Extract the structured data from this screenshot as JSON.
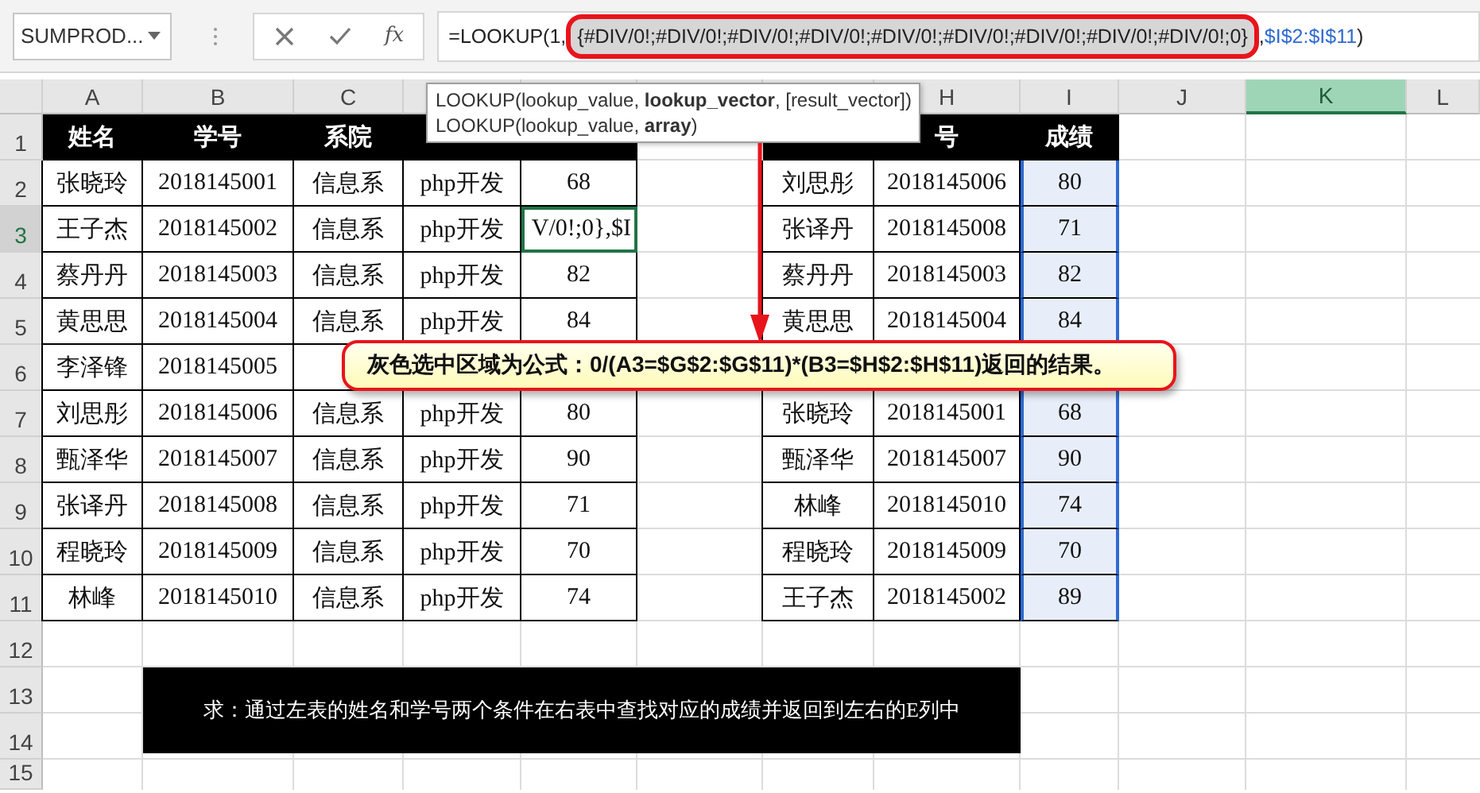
{
  "formula_bar": {
    "name_box": "SUMPROD...",
    "function_button": "fx",
    "parts": [
      {
        "kind": "plain",
        "text": "=LOOKUP(1,"
      },
      {
        "kind": "array",
        "text": "{#DIV/0!;#DIV/0!;#DIV/0!;#DIV/0!;#DIV/0!;#DIV/0!;#DIV/0!;#DIV/0!;#DIV/0!;0}"
      },
      {
        "kind": "plain",
        "text": ","
      },
      {
        "kind": "reference",
        "text": "$I$2:$I$11"
      },
      {
        "kind": "plain",
        "text": ")"
      }
    ]
  },
  "tooltip": {
    "lines": [
      "LOOKUP(lookup_value, **lookup_vector**, [result_vector])",
      "LOOKUP(lookup_value, **array**)"
    ]
  },
  "sheet": {
    "columns": [
      {
        "label": "A",
        "selected": false
      },
      {
        "label": "B",
        "selected": false
      },
      {
        "label": "C",
        "selected": false
      },
      {
        "selected": false
      },
      {
        "selected": false
      },
      {
        "selected": false
      },
      {
        "selected": false
      },
      {
        "label": "H",
        "selected": false
      },
      {
        "label": "I",
        "selected": false
      },
      {
        "label": "J",
        "selected": false
      },
      {
        "label": "K",
        "selected": true
      },
      {
        "label": "L",
        "selected": false
      }
    ],
    "rows": [
      {
        "number": "1",
        "selected": false,
        "cells": [
          {
            "kind": "header",
            "text": "姓名"
          },
          {
            "kind": "header",
            "text": "学号"
          },
          {
            "kind": "header",
            "text": "系院"
          },
          {
            "kind": "header"
          },
          {
            "kind": "header"
          },
          {
            "kind": "blank"
          },
          {
            "kind": "header"
          },
          {
            "kind": "header",
            "text": "号"
          },
          {
            "kind": "header",
            "text": "成绩"
          }
        ]
      },
      {
        "number": "2",
        "selected": false,
        "cells": [
          {
            "kind": "text",
            "text": "张晓玲"
          },
          {
            "kind": "text",
            "text": "2018145001"
          },
          {
            "kind": "text",
            "text": "信息系"
          },
          {
            "kind": "text",
            "text": "php开发"
          },
          {
            "kind": "text",
            "text": "68"
          },
          {
            "kind": "blank"
          },
          {
            "kind": "text",
            "text": "刘思彤"
          },
          {
            "kind": "text",
            "text": "2018145006"
          },
          {
            "kind": "reference",
            "text": "80"
          }
        ]
      },
      {
        "number": "3",
        "selected": true,
        "cells": [
          {
            "kind": "text",
            "text": "王子杰"
          },
          {
            "kind": "text",
            "text": "2018145002"
          },
          {
            "kind": "text",
            "text": "信息系"
          },
          {
            "kind": "text",
            "text": "php开发"
          },
          {
            "kind": "editing",
            "text": "V/0!;0},$I"
          },
          {
            "kind": "blank"
          },
          {
            "kind": "text",
            "text": "张译丹"
          },
          {
            "kind": "text",
            "text": "2018145008"
          },
          {
            "kind": "reference",
            "text": "71"
          }
        ]
      },
      {
        "number": "4",
        "selected": false,
        "cells": [
          {
            "kind": "text",
            "text": "蔡丹丹"
          },
          {
            "kind": "text",
            "text": "2018145003"
          },
          {
            "kind": "text",
            "text": "信息系"
          },
          {
            "kind": "text",
            "text": "php开发"
          },
          {
            "kind": "text",
            "text": "82"
          },
          {
            "kind": "blank"
          },
          {
            "kind": "text",
            "text": "蔡丹丹"
          },
          {
            "kind": "text",
            "text": "2018145003"
          },
          {
            "kind": "reference",
            "text": "82"
          }
        ]
      },
      {
        "number": "5",
        "selected": false,
        "cells": [
          {
            "kind": "text",
            "text": "黄思思"
          },
          {
            "kind": "text",
            "text": "2018145004"
          },
          {
            "kind": "text",
            "text": "信息系"
          },
          {
            "kind": "text",
            "text": "php开发"
          },
          {
            "kind": "text",
            "text": "84"
          },
          {
            "kind": "blank"
          },
          {
            "kind": "text",
            "text": "黄思思"
          },
          {
            "kind": "text",
            "text": "2018145004"
          },
          {
            "kind": "reference",
            "text": "84"
          }
        ]
      },
      {
        "number": "6",
        "selected": false,
        "cells": [
          {
            "kind": "text",
            "text": "李泽锋"
          },
          {
            "kind": "text",
            "text": "2018145005"
          },
          {
            "kind": "text"
          },
          {
            "kind": "text"
          },
          {
            "kind": "text"
          },
          {
            "kind": "blank"
          },
          {
            "kind": "text"
          },
          {
            "kind": "text"
          },
          {
            "kind": "reference"
          }
        ]
      },
      {
        "number": "7",
        "selected": false,
        "cells": [
          {
            "kind": "text",
            "text": "刘思彤"
          },
          {
            "kind": "text",
            "text": "2018145006"
          },
          {
            "kind": "text",
            "text": "信息系"
          },
          {
            "kind": "text",
            "text": "php开发"
          },
          {
            "kind": "text",
            "text": "80"
          },
          {
            "kind": "blank"
          },
          {
            "kind": "text",
            "text": "张晓玲"
          },
          {
            "kind": "text",
            "text": "2018145001"
          },
          {
            "kind": "reference",
            "text": "68"
          }
        ]
      },
      {
        "number": "8",
        "selected": false,
        "cells": [
          {
            "kind": "text",
            "text": "甄泽华"
          },
          {
            "kind": "text",
            "text": "2018145007"
          },
          {
            "kind": "text",
            "text": "信息系"
          },
          {
            "kind": "text",
            "text": "php开发"
          },
          {
            "kind": "text",
            "text": "90"
          },
          {
            "kind": "blank"
          },
          {
            "kind": "text",
            "text": "甄泽华"
          },
          {
            "kind": "text",
            "text": "2018145007"
          },
          {
            "kind": "reference",
            "text": "90"
          }
        ]
      },
      {
        "number": "9",
        "selected": false,
        "cells": [
          {
            "kind": "text",
            "text": "张译丹"
          },
          {
            "kind": "text",
            "text": "2018145008"
          },
          {
            "kind": "text",
            "text": "信息系"
          },
          {
            "kind": "text",
            "text": "php开发"
          },
          {
            "kind": "text",
            "text": "71"
          },
          {
            "kind": "blank"
          },
          {
            "kind": "text",
            "text": "林峰"
          },
          {
            "kind": "text",
            "text": "2018145010"
          },
          {
            "kind": "reference",
            "text": "74"
          }
        ]
      },
      {
        "number": "10",
        "selected": false,
        "cells": [
          {
            "kind": "text",
            "text": "程晓玲"
          },
          {
            "kind": "text",
            "text": "2018145009"
          },
          {
            "kind": "text",
            "text": "信息系"
          },
          {
            "kind": "text",
            "text": "php开发"
          },
          {
            "kind": "text",
            "text": "70"
          },
          {
            "kind": "blank"
          },
          {
            "kind": "text",
            "text": "程晓玲"
          },
          {
            "kind": "text",
            "text": "2018145009"
          },
          {
            "kind": "reference",
            "text": "70"
          }
        ]
      },
      {
        "number": "11",
        "selected": false,
        "cells": [
          {
            "kind": "text",
            "text": "林峰"
          },
          {
            "kind": "text",
            "text": "2018145010"
          },
          {
            "kind": "text",
            "text": "信息系"
          },
          {
            "kind": "text",
            "text": "php开发"
          },
          {
            "kind": "text",
            "text": "74"
          },
          {
            "kind": "blank"
          },
          {
            "kind": "text",
            "text": "王子杰"
          },
          {
            "kind": "text",
            "text": "2018145002"
          },
          {
            "kind": "reference",
            "text": "89"
          }
        ]
      },
      {
        "number": "12",
        "selected": false
      },
      {
        "number": "13",
        "selected": false
      },
      {
        "number": "14",
        "selected": false
      },
      {
        "number": "15",
        "selected": false
      }
    ],
    "banner": {
      "text": "求：通过左表的姓名和学号两个条件在右表中查找对应的成绩并返回到左右的E列中"
    }
  },
  "callout": {
    "text": "灰色选中区域为公式：0/(A3=$G$2:$G$11)*(B3=$H$2:$H$11)返回的结果。"
  }
}
